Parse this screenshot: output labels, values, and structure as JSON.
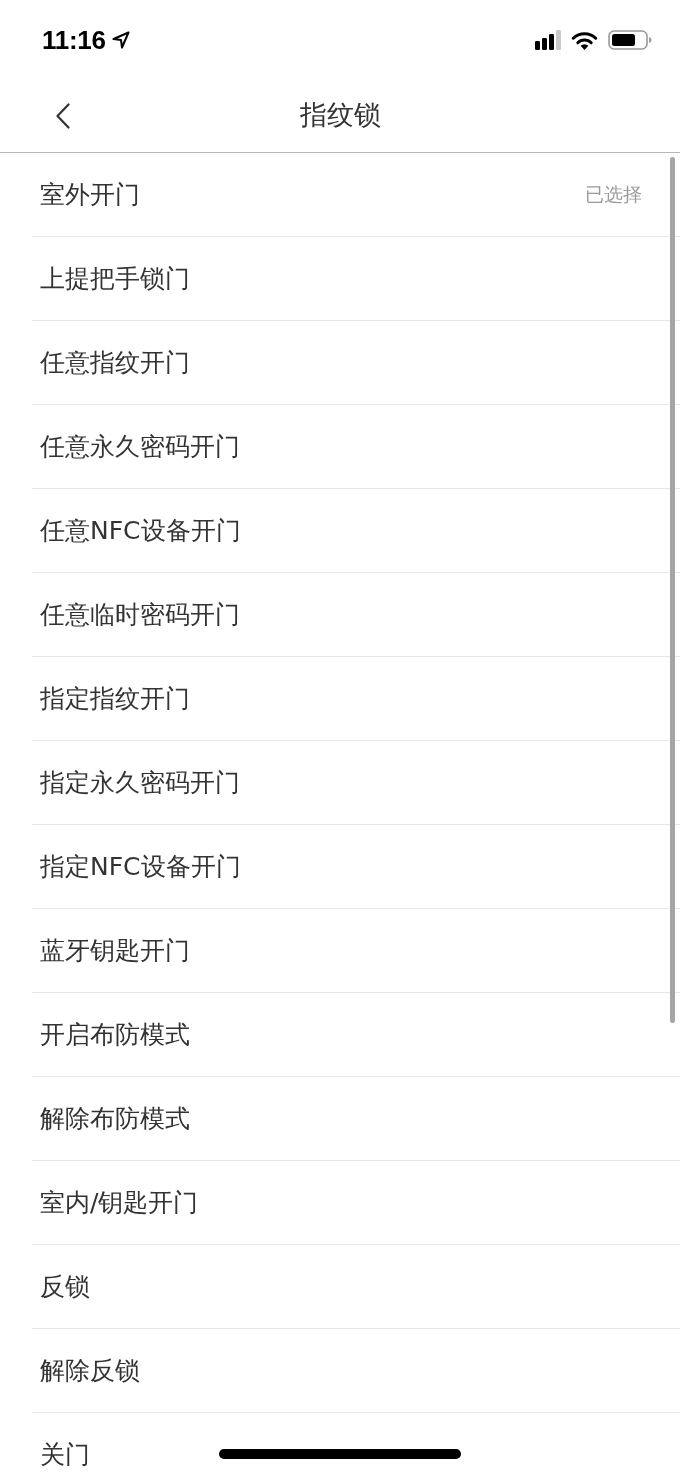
{
  "status_bar": {
    "time": "11:16"
  },
  "nav": {
    "title": "指纹锁"
  },
  "list": {
    "selected_text": "已选择",
    "items": [
      {
        "label": "室外开门",
        "selected": true
      },
      {
        "label": "上提把手锁门",
        "selected": false
      },
      {
        "label": "任意指纹开门",
        "selected": false
      },
      {
        "label": "任意永久密码开门",
        "selected": false
      },
      {
        "label": "任意NFC设备开门",
        "selected": false
      },
      {
        "label": "任意临时密码开门",
        "selected": false
      },
      {
        "label": "指定指纹开门",
        "selected": false
      },
      {
        "label": "指定永久密码开门",
        "selected": false
      },
      {
        "label": "指定NFC设备开门",
        "selected": false
      },
      {
        "label": "蓝牙钥匙开门",
        "selected": false
      },
      {
        "label": "开启布防模式",
        "selected": false
      },
      {
        "label": "解除布防模式",
        "selected": false
      },
      {
        "label": "室内/钥匙开门",
        "selected": false
      },
      {
        "label": "反锁",
        "selected": false
      },
      {
        "label": "解除反锁",
        "selected": false
      },
      {
        "label": "关门",
        "selected": false
      }
    ]
  }
}
